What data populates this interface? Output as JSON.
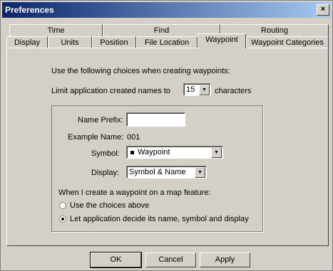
{
  "window": {
    "title": "Preferences",
    "close_glyph": "×"
  },
  "tabs_back": [
    "Time",
    "Find",
    "Routing"
  ],
  "tabs_front": [
    "Display",
    "Units",
    "Position",
    "File Location",
    "Waypoint",
    "Waypoint Categories"
  ],
  "active_tab": "Waypoint",
  "panel": {
    "intro": "Use the following choices when creating waypoints:",
    "limit_label": "Limit application created names to",
    "limit_value": "15",
    "limit_suffix": "characters",
    "name_prefix_label": "Name Prefix:",
    "name_prefix_value": "",
    "example_label": "Example Name:",
    "example_value": "001",
    "symbol_label": "Symbol:",
    "symbol_value": "Waypoint",
    "display_label": "Display:",
    "display_value": "Symbol & Name",
    "feature_label": "When I create a waypoint on a map feature:",
    "radio_1": "Use the choices above",
    "radio_2": "Let application decide its name, symbol and display",
    "radio_selected": 2
  },
  "buttons": {
    "ok": "OK",
    "cancel": "Cancel",
    "apply": "Apply"
  }
}
